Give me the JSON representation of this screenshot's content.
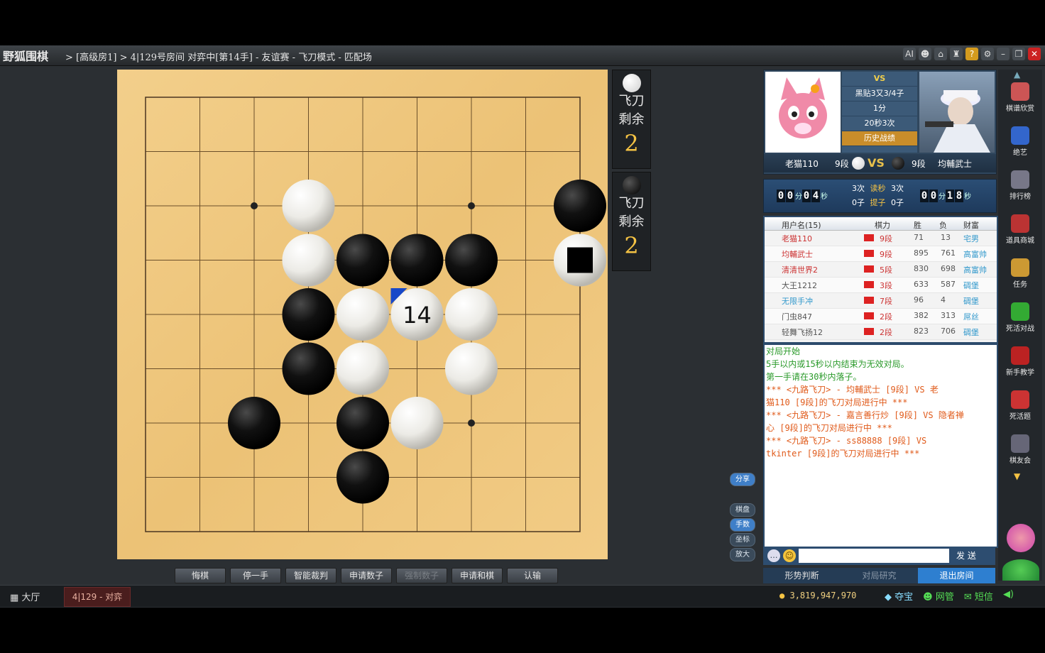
{
  "titlebar": {
    "logo": "野狐围棋",
    "path": "> [高级房1] > 4|129号房间 对弈中[第14手] - 友谊赛 - 飞刀模式 - 匹配场",
    "icons": [
      "ai-icon",
      "user-icon",
      "home-icon",
      "shirt-icon",
      "help-icon",
      "gear-icon",
      "minimize-icon",
      "restore-icon",
      "close-icon"
    ],
    "ai_label": "AI"
  },
  "board": {
    "size": 9,
    "white_stones": [
      [
        3,
        2
      ],
      [
        3,
        3
      ],
      [
        4,
        4
      ],
      [
        5,
        4
      ],
      [
        6,
        4
      ],
      [
        4,
        5
      ],
      [
        6,
        5
      ],
      [
        5,
        6
      ],
      [
        8,
        3
      ]
    ],
    "black_stones": [
      [
        8,
        2
      ],
      [
        4,
        3
      ],
      [
        5,
        3
      ],
      [
        6,
        3
      ],
      [
        3,
        4
      ],
      [
        3,
        5
      ],
      [
        2,
        6
      ],
      [
        4,
        6
      ],
      [
        4,
        7
      ]
    ],
    "last_move": {
      "col": 5,
      "row": 4,
      "number": "14"
    },
    "marked_stone": {
      "col": 8,
      "row": 3
    }
  },
  "knife_panels": [
    {
      "stone": "white",
      "line1": "飞刀",
      "line2": "剩余",
      "count": "2"
    },
    {
      "stone": "black",
      "line1": "飞刀",
      "line2": "剩余",
      "count": "2"
    }
  ],
  "side_buttons": [
    "分享",
    "棋盘",
    "手数",
    "坐标",
    "放大"
  ],
  "bottom_buttons": [
    "悔棋",
    "停一手",
    "智能裁判",
    "申请数子",
    "强制数子",
    "申请和棋",
    "认输"
  ],
  "vs": {
    "rules": "黑贴3又3/4子",
    "main_time": "1分",
    "byoyomi": "20秒3次",
    "history": "历史战绩",
    "left_name": "老猫110",
    "left_rank": "9段",
    "right_name": "均輔武士",
    "right_rank": "9段",
    "vs_label": "VS"
  },
  "timers": {
    "left": [
      "0",
      "0",
      "分",
      "0",
      "4",
      "秒"
    ],
    "right": [
      "0",
      "0",
      "分",
      "1",
      "8",
      "秒"
    ],
    "left_count": "3次",
    "right_count": "3次",
    "read_label": "读秒",
    "left_captures": "0子",
    "right_captures": "0子",
    "capture_label": "提子"
  },
  "userlist": {
    "headers": [
      "用户名(15)",
      "棋力",
      "胜",
      "负",
      "财富"
    ],
    "rows": [
      {
        "name": "老猫110",
        "rank": "9段",
        "wins": "71",
        "losses": "13",
        "wealth": "宅男",
        "color": "#c33"
      },
      {
        "name": "均輔武士",
        "rank": "9段",
        "wins": "895",
        "losses": "761",
        "wealth": "高富帅",
        "color": "#c33"
      },
      {
        "name": "清清世界2",
        "rank": "5段",
        "wins": "830",
        "losses": "698",
        "wealth": "高富帅",
        "color": "#c33"
      },
      {
        "name": "大王1212",
        "rank": "3段",
        "wins": "633",
        "losses": "587",
        "wealth": "碉堡",
        "color": "#555"
      },
      {
        "name": "无限手冲",
        "rank": "7段",
        "wins": "96",
        "losses": "4",
        "wealth": "碉堡",
        "color": "#39c"
      },
      {
        "name": "门虫847",
        "rank": "2段",
        "wins": "382",
        "losses": "313",
        "wealth": "屌丝",
        "color": "#555"
      },
      {
        "name": "轻舞飞扬12",
        "rank": "2段",
        "wins": "823",
        "losses": "706",
        "wealth": "碉堡",
        "color": "#555"
      }
    ]
  },
  "chat": {
    "lines": [
      {
        "text": "对局开始",
        "color": "#2a9a2a"
      },
      {
        "text": "5手以内或15秒以内结束为无效对局。",
        "color": "#2a9a2a"
      },
      {
        "text": "第一手请在30秒内落子。",
        "color": "#2a9a2a"
      },
      {
        "text": "*** <九路飞刀> - 均輔武士 [9段] VS 老",
        "color": "#e05a1a"
      },
      {
        "text": "猫110 [9段]的飞刀对局进行中 ***",
        "color": "#e05a1a"
      },
      {
        "text": "*** <九路飞刀> - 嘉言善行炒 [9段] VS 隐者禅",
        "color": "#e05a1a"
      },
      {
        "text": "心 [9段]的飞刀对局进行中 ***",
        "color": "#e05a1a"
      },
      {
        "text": "*** <九路飞刀> - ss88888 [9段] VS",
        "color": "#e05a1a"
      },
      {
        "text": "tkinter [9段]的飞刀对局进行中 ***",
        "color": "#e05a1a"
      }
    ],
    "send_label": "发 送"
  },
  "chat_tabs": [
    "形势判断",
    "对局研究",
    "退出房间"
  ],
  "rightbar": [
    "棋谱欣赏",
    "绝艺",
    "排行榜",
    "道具商城",
    "任务",
    "死活对战",
    "新手教学",
    "死活题",
    "棋友会"
  ],
  "taskbar": {
    "hall": "大厅",
    "room": "4|129 - 对弈",
    "coins": "3,819,947,970",
    "treasure": "夺宝",
    "net": "网管",
    "sms": "短信"
  },
  "colors": {
    "board": "#ecc276",
    "accent_blue": "#2e7fd0",
    "knife_gold": "#f5c344"
  }
}
